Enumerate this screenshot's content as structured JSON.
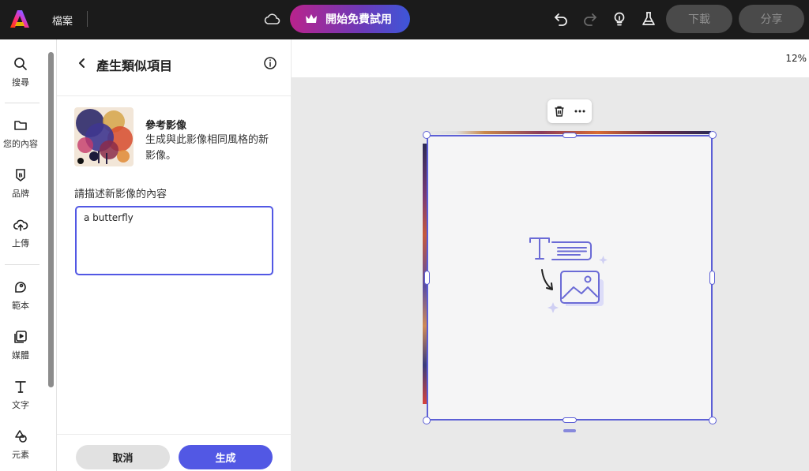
{
  "app": {
    "filename": "檔案",
    "trial_button": "開始免費試用",
    "download_button": "下載",
    "share_button": "分享"
  },
  "rail": {
    "items": [
      {
        "label": "搜尋",
        "icon": "search-icon"
      },
      {
        "label": "您的內容",
        "icon": "folder-icon"
      },
      {
        "label": "品牌",
        "icon": "brand-icon"
      },
      {
        "label": "上傳",
        "icon": "upload-icon"
      },
      {
        "label": "範本",
        "icon": "template-icon"
      },
      {
        "label": "媒體",
        "icon": "media-icon"
      },
      {
        "label": "文字",
        "icon": "text-icon"
      },
      {
        "label": "元素",
        "icon": "elements-icon"
      }
    ]
  },
  "panel": {
    "title": "產生類似項目",
    "reference_title": "參考影像",
    "reference_desc": "生成與此影像相同風格的新影像。",
    "prompt_label": "請描述新影像的內容",
    "prompt_value": "a butterfly",
    "cancel": "取消",
    "generate": "生成"
  },
  "canvas": {
    "zoom": "12%"
  },
  "colors": {
    "accent": "#5258e4",
    "topbar": "#1b1b1b"
  }
}
